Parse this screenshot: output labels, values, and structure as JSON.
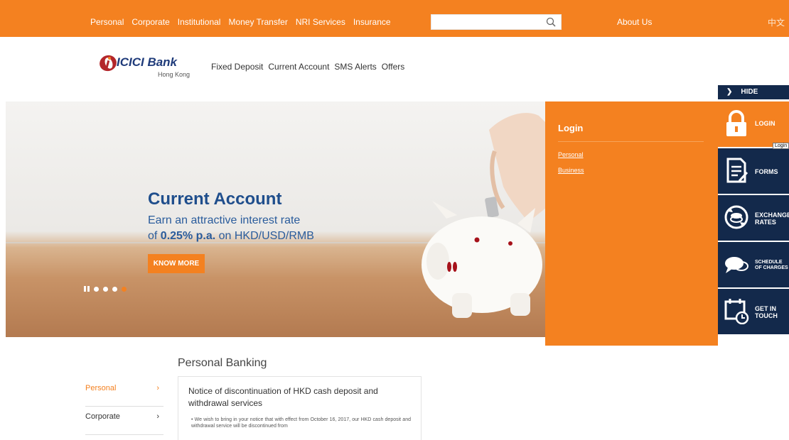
{
  "topnav": {
    "items": [
      "Personal",
      "Corporate",
      "Institutional",
      "Money Transfer",
      "NRI Services",
      "Insurance"
    ],
    "search_placeholder": "",
    "about": "About Us",
    "lang": "中文"
  },
  "brand": {
    "name": "ICICI Bank",
    "sub": "Hong Kong"
  },
  "subnav": [
    "Fixed Deposit",
    "Current Account",
    "SMS Alerts",
    "Offers"
  ],
  "hero": {
    "title": "Current Account",
    "line1": "Earn an attractive interest rate",
    "line2_prefix": "of ",
    "line2_bold": "0.25% p.a.",
    "line2_suffix": " on HKD/USD/RMB",
    "button": "KNOW MORE",
    "slides": 4,
    "active_slide": 4
  },
  "login_panel": {
    "title": "Login",
    "links": [
      "Personal",
      "Business"
    ]
  },
  "rail": {
    "hide": "HIDE",
    "tooltip": "Login",
    "items": [
      {
        "label": [
          "LOGIN"
        ]
      },
      {
        "label": [
          "FORMS"
        ]
      },
      {
        "label": [
          "EXCHANGE",
          "RATES"
        ]
      },
      {
        "label": [
          "SCHEDULE",
          "OF CHARGES"
        ]
      },
      {
        "label": [
          "GET IN",
          "TOUCH"
        ]
      }
    ]
  },
  "left_menu": [
    {
      "label": "Personal",
      "active": true
    },
    {
      "label": "Corporate",
      "active": false
    }
  ],
  "content": {
    "section_title": "Personal Banking",
    "notice_title": "Notice of discontinuation of HKD cash deposit and withdrawal services",
    "notice_body": "• We wish to bring in your notice that with effect from October 16, 2017, our HKD cash deposit and withdrawal service will be discontinued from"
  },
  "colors": {
    "brand_orange": "#f48120",
    "navy": "#13294b",
    "blue_text": "#1f4e8c"
  }
}
